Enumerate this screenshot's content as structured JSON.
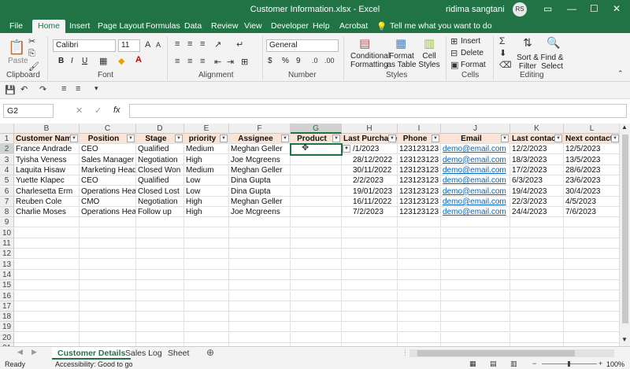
{
  "window": {
    "title": "Customer Information.xlsx  -  Excel",
    "user": "ridima sangtani",
    "avatar": "RS"
  },
  "tabs": [
    "File",
    "Home",
    "Insert",
    "Page Layout",
    "Formulas",
    "Data",
    "Review",
    "View",
    "Developer",
    "Help",
    "Acrobat"
  ],
  "tell_me": "Tell me what you want to do",
  "ribbon": {
    "clipboard": {
      "paste": "Paste",
      "label": "Clipboard"
    },
    "font": {
      "name": "Calibri",
      "size": "11",
      "label": "Font",
      "bold": "B",
      "italic": "I",
      "underline": "U"
    },
    "alignment": {
      "label": "Alignment"
    },
    "number": {
      "format": "General",
      "label": "Number",
      "currency": "$",
      "percent": "%",
      "comma": "9"
    },
    "styles": {
      "conditional": "Conditional Formatting",
      "format_table": "Format as Table",
      "cell_styles": "Cell Styles",
      "label": "Styles"
    },
    "cells": {
      "insert": "Insert",
      "delete": "Delete",
      "format": "Format",
      "label": "Cells"
    },
    "editing": {
      "sort": "Sort & Filter",
      "find": "Find & Select",
      "label": "Editing"
    }
  },
  "formula_bar": {
    "name_box": "G2",
    "fx": "fx",
    "value": ""
  },
  "columns": [
    {
      "letter": "B",
      "header": "Customer Name"
    },
    {
      "letter": "C",
      "header": "Position"
    },
    {
      "letter": "D",
      "header": "Stage"
    },
    {
      "letter": "E",
      "header": "priority"
    },
    {
      "letter": "F",
      "header": "Assignee"
    },
    {
      "letter": "G",
      "header": "Product"
    },
    {
      "letter": "H",
      "header": "Last Purchase"
    },
    {
      "letter": "I",
      "header": "Phone"
    },
    {
      "letter": "J",
      "header": "Email"
    },
    {
      "letter": "K",
      "header": "Last contact"
    },
    {
      "letter": "L",
      "header": "Next contact"
    }
  ],
  "rows": [
    [
      "France Andrade",
      "CEO",
      "Qualified",
      "Medium",
      "Meghan Geller",
      "",
      "/1/2023",
      "123123123",
      "demo@email.com",
      "12/2/2023",
      "12/5/2023"
    ],
    [
      "Tyisha Veness",
      "Sales Manager",
      "Negotiation",
      "High",
      "Joe Mcgreens",
      "",
      "28/12/2022",
      "123123123",
      "demo@email.com",
      "18/3/2023",
      "13/5/2023"
    ],
    [
      "Laquita Hisaw",
      "Marketing Head",
      "Closed Won",
      "Medium",
      "Meghan Geller",
      "",
      "30/11/2022",
      "123123123",
      "demo@email.com",
      "17/2/2023",
      "28/6/2023"
    ],
    [
      "Yuette Klapec",
      "CEO",
      "Qualified",
      "Low",
      "Dina Gupta",
      "",
      "2/2/2023",
      "123123123",
      "demo@email.com",
      "6/3/2023",
      "23/6/2023"
    ],
    [
      "Charlesetta Erm",
      "Operations Head",
      "Closed Lost",
      "Low",
      "Dina Gupta",
      "",
      "19/01/2023",
      "123123123",
      "demo@email.com",
      "19/4/2023",
      "30/4/2023"
    ],
    [
      "Reuben Cole",
      "CMO",
      "Negotiation",
      "High",
      "Meghan Geller",
      "",
      "16/11/2022",
      "123123123",
      "demo@email.com",
      "22/3/2023",
      "4/5/2023"
    ],
    [
      "Charlie Moses",
      "Operations Head",
      "Follow up",
      "High",
      "Joe Mcgreens",
      "",
      "7/2/2023",
      "123123123",
      "demo@email.com",
      "24/4/2023",
      "7/6/2023"
    ]
  ],
  "row_numbers": [
    "1",
    "2",
    "3",
    "4",
    "5",
    "6",
    "7",
    "8",
    "9",
    "10",
    "11",
    "12",
    "13",
    "14",
    "15",
    "16",
    "17",
    "18",
    "19",
    "20",
    "21"
  ],
  "sheet_tabs": [
    "Customer Details",
    "Sales Log",
    "Sheet"
  ],
  "status": {
    "ready": "Ready",
    "accessibility": "Accessibility: Good to go",
    "zoom": "100%"
  }
}
